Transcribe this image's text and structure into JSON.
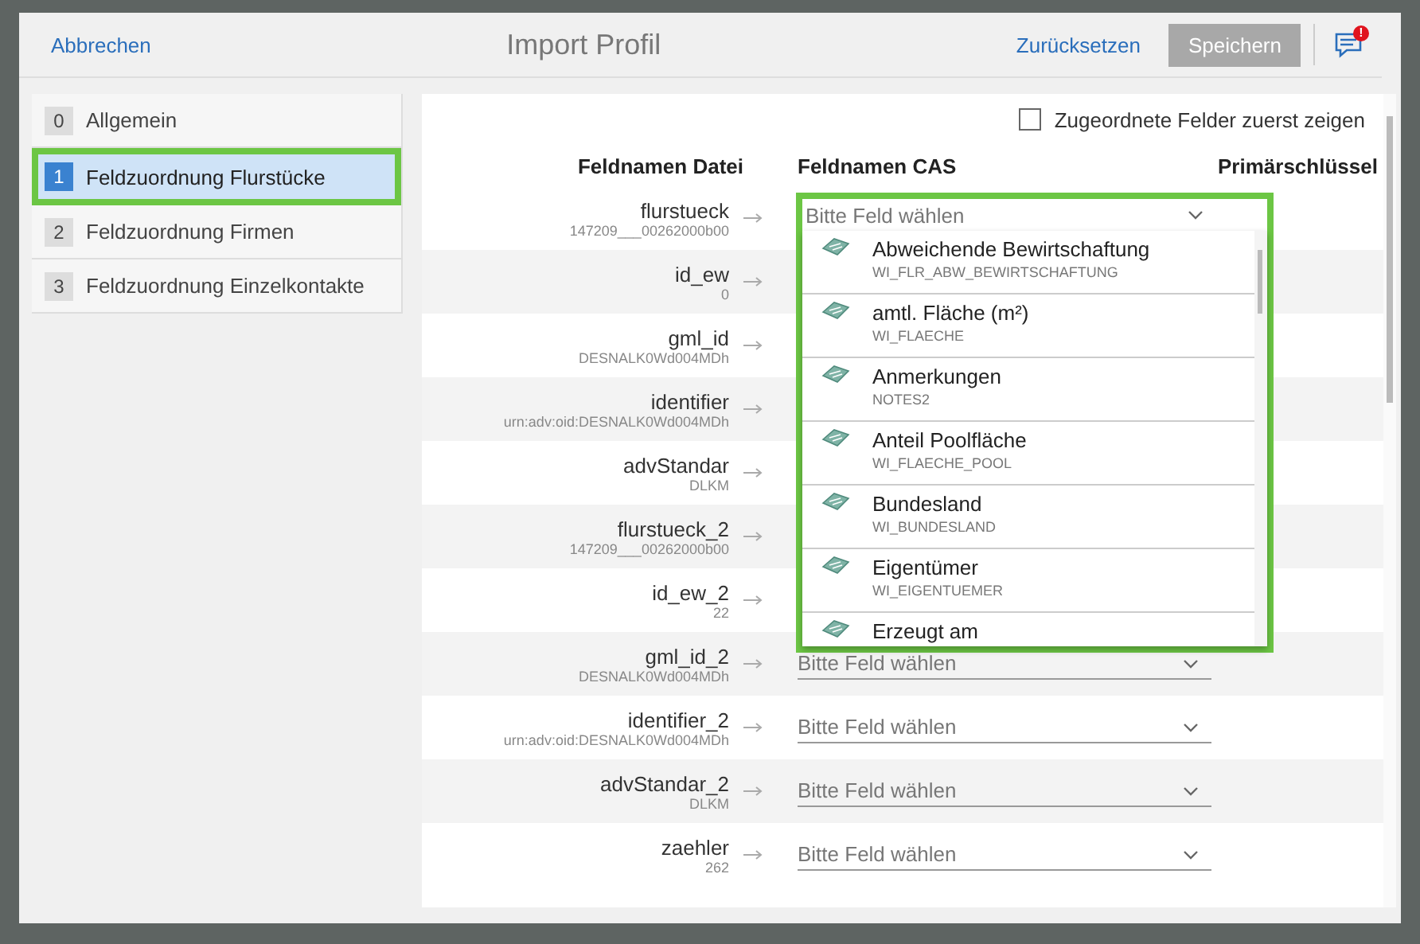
{
  "header": {
    "cancel": "Abbrechen",
    "title": "Import Profil",
    "reset": "Zurücksetzen",
    "save": {
      "label": "Speichern",
      "disabled": true
    },
    "notification_badge": "!"
  },
  "steps": [
    {
      "number": "0",
      "label": "Allgemein",
      "selected": false
    },
    {
      "number": "1",
      "label": "Feldzuordnung Flurstücke",
      "selected": true
    },
    {
      "number": "2",
      "label": "Feldzuordnung Firmen",
      "selected": false
    },
    {
      "number": "3",
      "label": "Feldzuordnung Einzelkontakte",
      "selected": false
    }
  ],
  "assigned_first": {
    "label": "Zugeordnete Felder zuerst zeigen",
    "checked": false
  },
  "columns": [
    "Feldnamen Datei",
    "Feldnamen CAS",
    "Primärschlüssel"
  ],
  "rows": [
    {
      "name": "flurstueck",
      "value": "147209___00262000b00"
    },
    {
      "name": "id_ew",
      "value": "0"
    },
    {
      "name": "gml_id",
      "value": "DESNALK0Wd004MDh"
    },
    {
      "name": "identifier",
      "value": "urn:adv:oid:DESNALK0Wd004MDh"
    },
    {
      "name": "advStandar",
      "value": "DLKM"
    },
    {
      "name": "flurstueck_2",
      "value": "147209___00262000b00"
    },
    {
      "name": "id_ew_2",
      "value": "22"
    },
    {
      "name": "gml_id_2",
      "value": "DESNALK0Wd004MDh",
      "field": {
        "placeholder": "Bitte Feld wählen"
      }
    },
    {
      "name": "identifier_2",
      "value": "urn:adv:oid:DESNALK0Wd004MDh",
      "field": {
        "placeholder": "Bitte Feld wählen"
      }
    },
    {
      "name": "advStandar_2",
      "value": "DLKM",
      "field": {
        "placeholder": "Bitte Feld wählen"
      }
    },
    {
      "name": "zaehler",
      "value": "262",
      "field": {
        "placeholder": "Bitte Feld wählen"
      }
    }
  ],
  "dropdown": {
    "placeholder": "Bitte Feld wählen",
    "options": [
      {
        "label": "Abweichende Bewirtschaftung",
        "code": "WI_FLR_ABW_BEWIRTSCHAFTUNG"
      },
      {
        "label": "amtl. Fläche (m²)",
        "code": "WI_FLAECHE"
      },
      {
        "label": "Anmerkungen",
        "code": "NOTES2"
      },
      {
        "label": "Anteil Poolfläche",
        "code": "WI_FLAECHE_POOL"
      },
      {
        "label": "Bundesland",
        "code": "WI_BUNDESLAND"
      },
      {
        "label": "Eigentümer",
        "code": "WI_EIGENTUEMER"
      },
      {
        "label": "Erzeugt am"
      }
    ]
  }
}
